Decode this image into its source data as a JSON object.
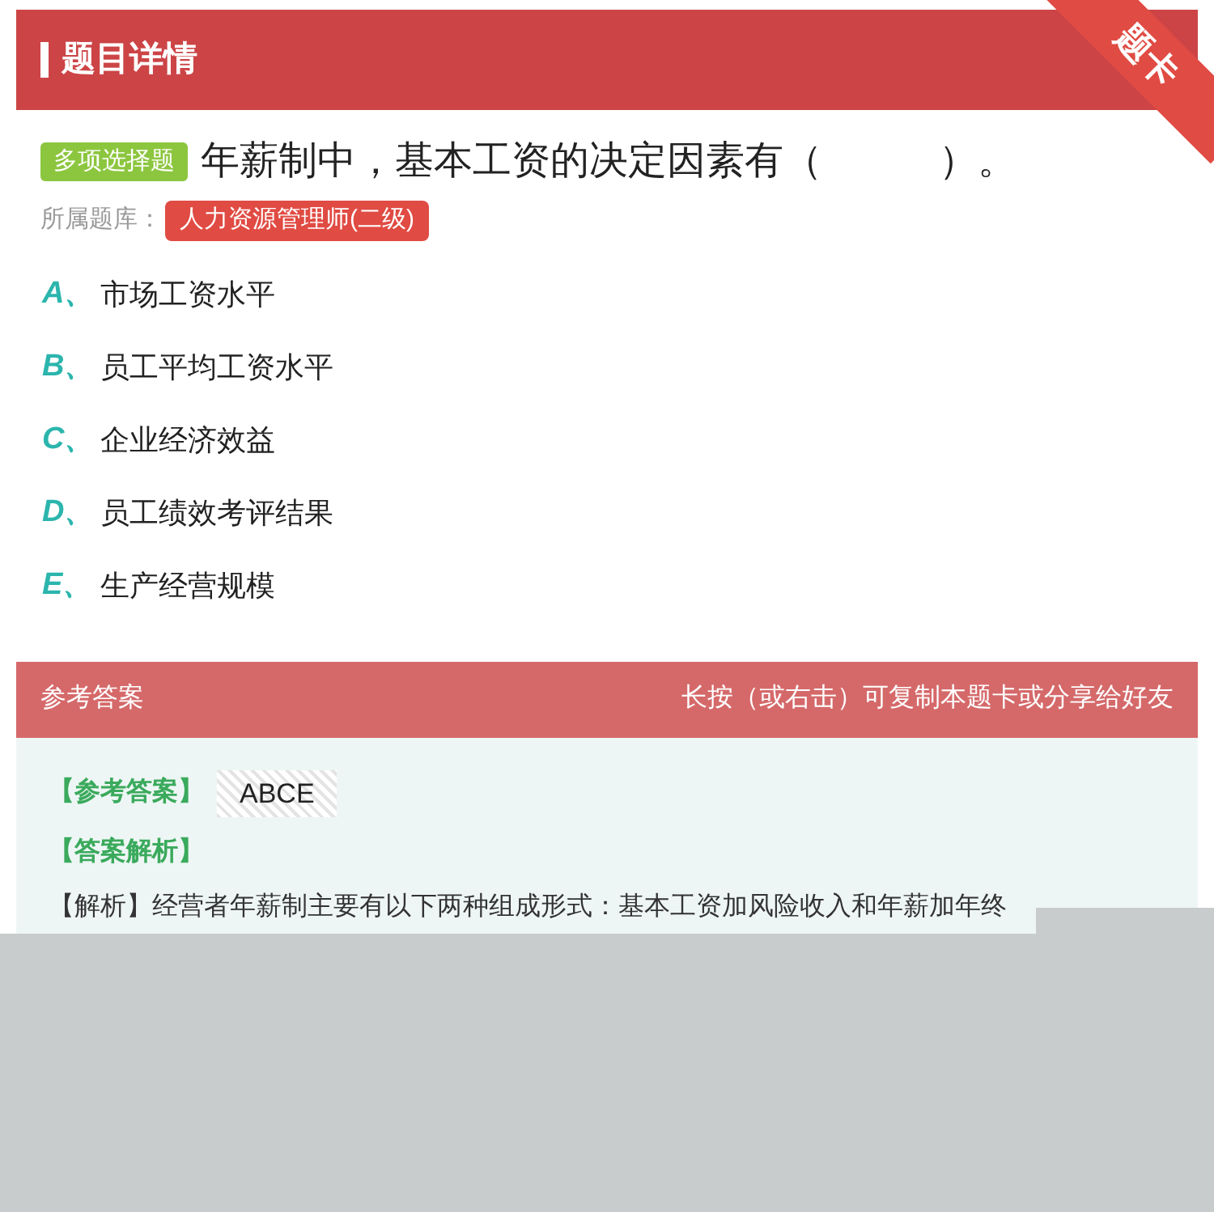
{
  "header": {
    "title": "题目详情",
    "ribbon": "题卡"
  },
  "question": {
    "type": "多项选择题",
    "text": "年薪制中，基本工资的决定因素有（　　　）。",
    "bank_label": "所属题库：",
    "bank": "人力资源管理师(二级)"
  },
  "options": [
    {
      "letter": "A、",
      "text": "市场工资水平"
    },
    {
      "letter": "B、",
      "text": "员工平均工资水平"
    },
    {
      "letter": "C、",
      "text": "企业经济效益"
    },
    {
      "letter": "D、",
      "text": "员工绩效考评结果"
    },
    {
      "letter": "E、",
      "text": "生产经营规模"
    }
  ],
  "answer_section": {
    "title": "参考答案",
    "hint": "长按（或右击）可复制本题卡或分享给好友",
    "answer_label": "【参考答案】",
    "answer": "ABCE",
    "analysis_label": "【答案解析】",
    "analysis": "【解析】经营者年薪制主要有以下两种组成形式：基本工资加风险收入和年薪加年终"
  }
}
